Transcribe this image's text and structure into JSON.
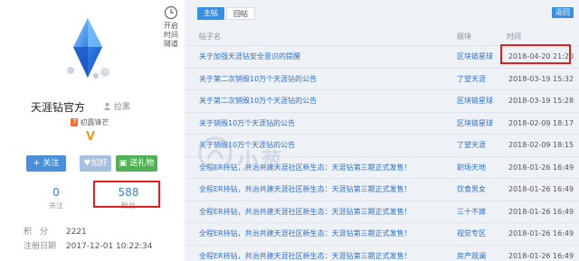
{
  "profile": {
    "name": "天涯钻官方",
    "blacklist_label": "拉黑",
    "level_badge": "7",
    "level_text": "初露锋芒",
    "vip_mark": "V",
    "timeline_lines": [
      "开启",
      "时间",
      "隧道"
    ],
    "buttons": {
      "follow": "+ 关注",
      "add_friend": "加好友",
      "gift": "送礼物"
    },
    "stats": {
      "following_count": "0",
      "following_label": "关注",
      "fans_count": "588",
      "fans_label": "粉丝"
    },
    "points_label": "积　分",
    "points_value": "2221",
    "reg_label": "注册日期",
    "reg_value": "2017-12-01 10:22:34"
  },
  "forum": {
    "tabs": [
      {
        "label": "主帖",
        "active": true
      },
      {
        "label": "回帖",
        "active": false
      }
    ],
    "back_label": "返回",
    "columns": {
      "title": "帖子名",
      "board": "版块",
      "time": "时间"
    },
    "watermark": "小葱",
    "rows": [
      {
        "title": "关于加强天涯钻安全意识的提醒",
        "board": "区块链星球",
        "time": "2018-04-20 21:20"
      },
      {
        "title": "关于第二次销毁10万个天涯钻的公告",
        "board": "了望天涯",
        "time": "2018-03-19 15:32"
      },
      {
        "title": "关于第二次销毁10万个天涯钻的公告",
        "board": "区块链星球",
        "time": "2018-03-19 15:28"
      },
      {
        "title": "关于销毁10万个天涯钻的公告",
        "board": "区块链星球",
        "time": "2018-02-09 18:17"
      },
      {
        "title": "关于销毁10万个天涯钻的公告",
        "board": "了望天涯",
        "time": "2018-02-09 18:15"
      },
      {
        "title": "全程ER持钻，共治共建天涯社区新生态：天涯钻第三期正式发售！",
        "board": "职场天地",
        "time": "2018-01-26 16:49"
      },
      {
        "title": "全程ER持钻，共治共建天涯社区新生态：天涯钻第三期正式发售！",
        "board": "饮食男女",
        "time": "2018-01-26 16:49"
      },
      {
        "title": "全程ER持钻，共治共建天涯社区新生态：天涯钻第三期正式发售！",
        "board": "三十不嫁",
        "time": "2018-01-26 16:49"
      },
      {
        "title": "全程ER持钻，共治共建天涯社区新生态：天涯钻第三期正式发售！",
        "board": "视觉专区",
        "time": "2018-01-26 16:49"
      },
      {
        "title": "全程ER持钻，共治共建天涯社区新生态：天涯钻第三期正式发售！",
        "board": "房产观澜",
        "time": "2018-01-26 16:49"
      }
    ]
  },
  "colors": {
    "accent": "#3a8fe0",
    "highlight": "#e02020",
    "link": "#2f6fc5"
  }
}
